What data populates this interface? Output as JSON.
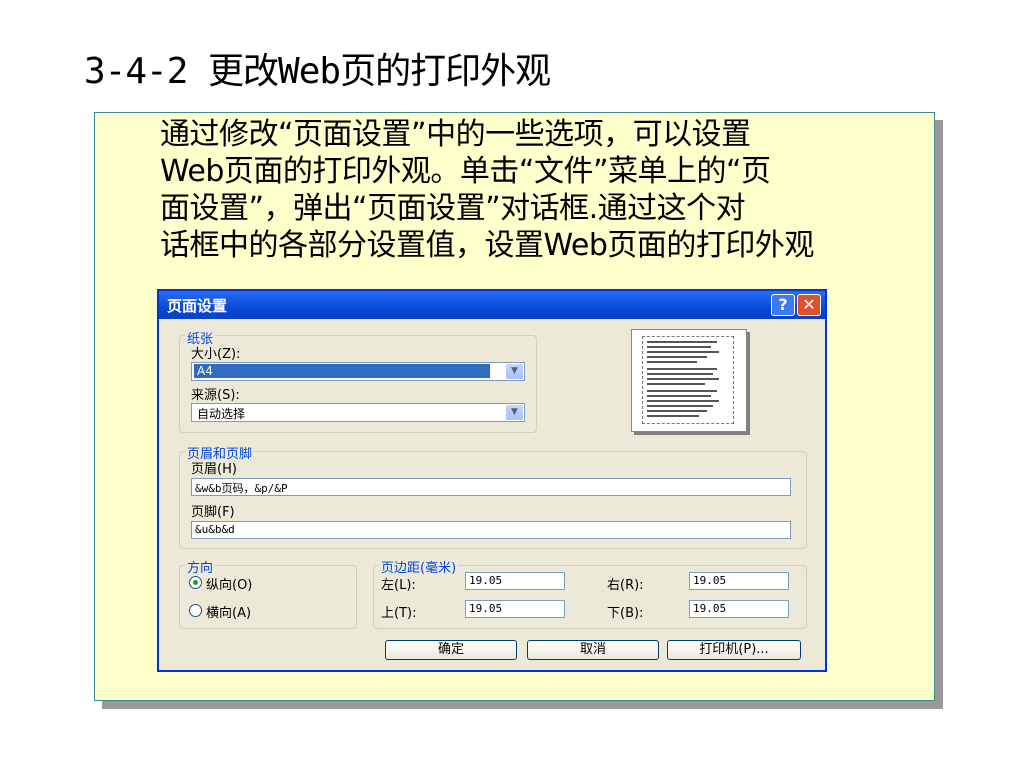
{
  "slide": {
    "title": "3-4-2 更改Web页的打印外观",
    "body_lines": [
      "通过修改“页面设置”中的一些选项，可以设置",
      "Web页面的打印外观。单击“文件”菜单上的“页",
      "面设置”，弹出“页面设置”对话框.通过这个对",
      "话框中的各部分设置值，设置Web页面的打印外观"
    ]
  },
  "dialog": {
    "title": "页面设置",
    "help_label": "?",
    "close_label": "✕",
    "paper": {
      "group_label": "纸张",
      "size_label": "大小(Z):",
      "size_value": "A4",
      "source_label": "来源(S):",
      "source_value": "自动选择"
    },
    "headers_footers": {
      "group_label": "页眉和页脚",
      "header_label": "页眉(H)",
      "header_value": "&w&b页码，&p/&P",
      "footer_label": "页脚(F)",
      "footer_value": "&u&b&d"
    },
    "orientation": {
      "group_label": "方向",
      "portrait_label": "纵向(O)",
      "landscape_label": "横向(A)"
    },
    "margins": {
      "group_label": "页边距(毫米)",
      "left_label": "左(L):",
      "left_value": "19.05",
      "right_label": "右(R):",
      "right_value": "19.05",
      "top_label": "上(T):",
      "top_value": "19.05",
      "bottom_label": "下(B):",
      "bottom_value": "19.05"
    },
    "buttons": {
      "ok": "确定",
      "cancel": "取消",
      "printer": "打印机(P)..."
    }
  }
}
